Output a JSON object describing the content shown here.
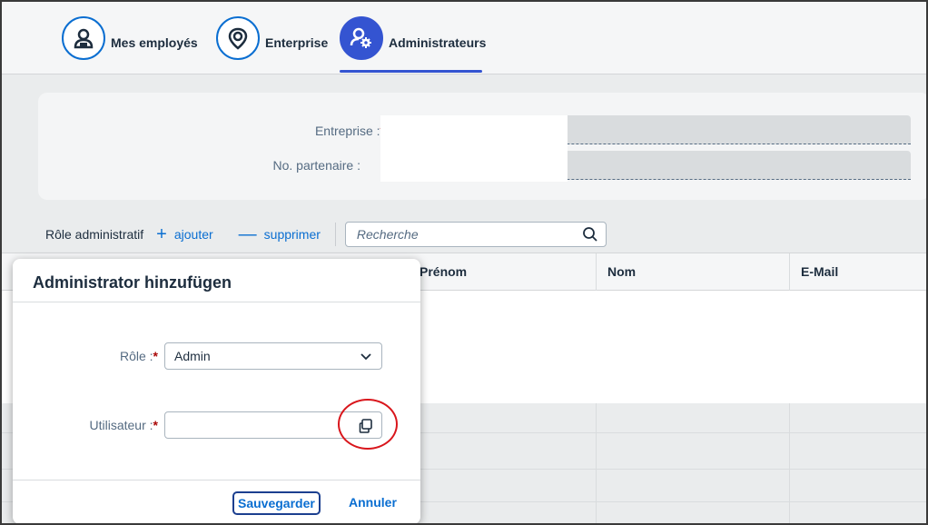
{
  "tabs": [
    {
      "label": "Mes employés",
      "icon": "person-badge-icon",
      "active": false
    },
    {
      "label": "Enterprise",
      "icon": "location-pin-icon",
      "active": false
    },
    {
      "label": "Administrateurs",
      "icon": "user-settings-icon",
      "active": true
    }
  ],
  "filter": {
    "company_label": "Entreprise :",
    "partner_label": "No. partenaire :",
    "required_mark": "*"
  },
  "toolbar": {
    "title": "Rôle administratif",
    "add_label": "ajouter",
    "delete_label": "supprimer",
    "search_placeholder": "Recherche"
  },
  "table": {
    "columns": [
      "Prénom",
      "Nom",
      "E-Mail"
    ]
  },
  "dialog": {
    "title": "Administrator hinzufügen",
    "role_label": "Rôle :",
    "role_value": "Admin",
    "user_label": "Utilisateur :",
    "user_value": "",
    "save_label": "Sauvegarder",
    "cancel_label": "Annuler"
  },
  "colors": {
    "accent": "#0a6ed1",
    "active_tab": "#3454d1",
    "required": "#aa0808",
    "highlight_circle": "#d9161c"
  }
}
